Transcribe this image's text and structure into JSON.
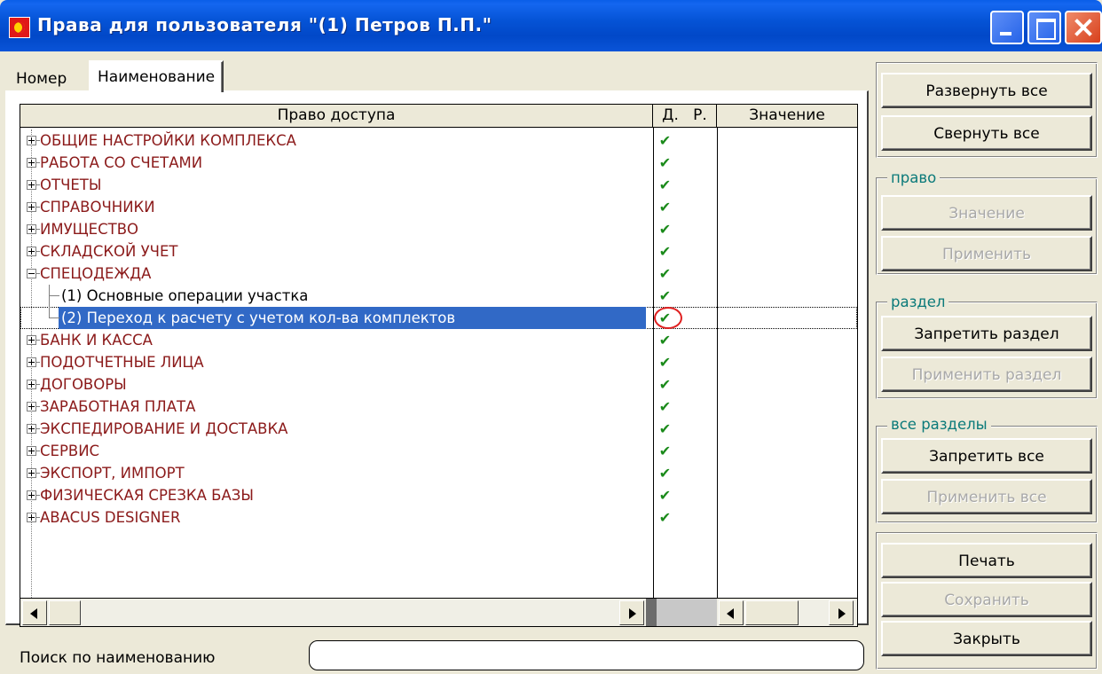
{
  "window": {
    "title": "Права для пользователя \"(1) Петров П.П.\""
  },
  "tabs": [
    {
      "label": "Номер"
    },
    {
      "label": "Наименование"
    }
  ],
  "grid": {
    "columns": {
      "name": "Право доступа",
      "d": "Д.",
      "r": "Р.",
      "value": "Значение"
    },
    "rows": [
      {
        "label": "ОБЩИЕ НАСТРОЙКИ КОМПЛЕКСА",
        "expander": "plus",
        "d": "✔"
      },
      {
        "label": "РАБОТА СО СЧЕТАМИ",
        "expander": "plus",
        "d": "✔"
      },
      {
        "label": "ОТЧЕТЫ",
        "expander": "plus",
        "d": "✔"
      },
      {
        "label": "СПРАВОЧНИКИ",
        "expander": "plus",
        "d": "✔"
      },
      {
        "label": "ИМУЩЕСТВО",
        "expander": "plus",
        "d": "✔"
      },
      {
        "label": "СКЛАДСКОЙ УЧЕТ",
        "expander": "plus",
        "d": "✔"
      },
      {
        "label": "СПЕЦОДЕЖДА",
        "expander": "minus",
        "d": "✔"
      },
      {
        "label": "(1) Основные операции участка",
        "child": true,
        "d": "✔"
      },
      {
        "label": "(2) Переход к расчету с учетом кол-ва комплектов",
        "child": true,
        "selected": true,
        "d": "✔"
      },
      {
        "label": "БАНК И КАССА",
        "expander": "plus",
        "d": "✔"
      },
      {
        "label": "ПОДОТЧЕТНЫЕ ЛИЦА",
        "expander": "plus",
        "d": "✔"
      },
      {
        "label": "ДОГОВОРЫ",
        "expander": "plus",
        "d": "✔"
      },
      {
        "label": "ЗАРАБОТНАЯ ПЛАТА",
        "expander": "plus",
        "d": "✔"
      },
      {
        "label": "ЭКСПЕДИРОВАНИЕ И ДОСТАВКА",
        "expander": "plus",
        "d": "✔"
      },
      {
        "label": "СЕРВИС",
        "expander": "plus",
        "d": "✔"
      },
      {
        "label": "ЭКСПОРТ, ИМПОРТ",
        "expander": "plus",
        "d": "✔"
      },
      {
        "label": "ФИЗИЧЕСКАЯ СРЕЗКА БАЗЫ",
        "expander": "plus",
        "d": "✔"
      },
      {
        "label": "ABACUS DESIGNER",
        "expander": "plus",
        "d": "✔"
      }
    ]
  },
  "search": {
    "label": "Поиск по наименованию",
    "value": ""
  },
  "right_panel": {
    "expand_all": "Развернуть все",
    "collapse_all": "Свернуть все",
    "group_right": "право",
    "value_button": "Значение",
    "apply_button": "Применить",
    "group_section": "раздел",
    "deny_section": "Запретить раздел",
    "apply_section": "Применить раздел",
    "group_all": "все разделы",
    "deny_all": "Запретить все",
    "apply_all": "Применить все",
    "print": "Печать",
    "save": "Сохранить",
    "close": "Закрыть"
  },
  "colors": {
    "title_bar": "#0553d6",
    "category_text": "#8b1a1a",
    "selection": "#3169c6",
    "check": "#1a8a1a",
    "group_legend": "#0b7a7a"
  }
}
